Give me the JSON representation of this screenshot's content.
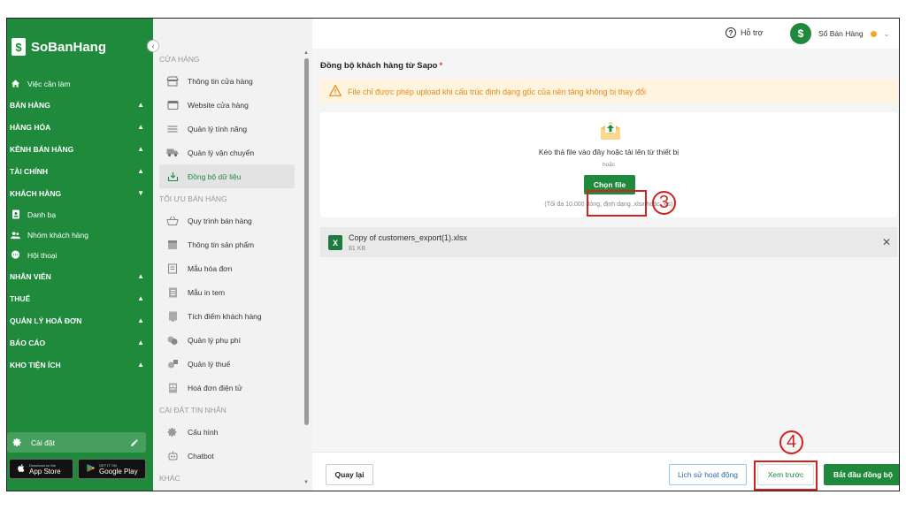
{
  "brand": {
    "name": "SoBanHang",
    "mark": "$"
  },
  "sidebar": {
    "items": [
      {
        "label": "Việc cần làm",
        "type": "link",
        "icon": "home-icon"
      },
      {
        "label": "BÁN HÀNG",
        "type": "group",
        "chevron": "▲"
      },
      {
        "label": "HÀNG HÓA",
        "type": "group",
        "chevron": "▲"
      },
      {
        "label": "KÊNH BÁN HÀNG",
        "type": "group",
        "chevron": "▲"
      },
      {
        "label": "TÀI CHÍNH",
        "type": "group",
        "chevron": "▲"
      },
      {
        "label": "KHÁCH HÀNG",
        "type": "group",
        "chevron": "▼"
      },
      {
        "label": "Danh bạ",
        "type": "sub",
        "icon": "contact-book-icon"
      },
      {
        "label": "Nhóm khách hàng",
        "type": "sub",
        "icon": "group-icon"
      },
      {
        "label": "Hội thoại",
        "type": "sub",
        "icon": "chat-icon"
      },
      {
        "label": "NHÂN VIÊN",
        "type": "group",
        "chevron": "▲"
      },
      {
        "label": "THUẾ",
        "type": "group",
        "chevron": "▲"
      },
      {
        "label": "QUẢN LÝ HOÁ ĐƠN",
        "type": "group",
        "chevron": "▲"
      },
      {
        "label": "BÁO CÁO",
        "type": "group",
        "chevron": "▲"
      },
      {
        "label": "KHO TIỆN ÍCH",
        "type": "group",
        "chevron": "▲"
      }
    ],
    "settings_label": "Cài đặt",
    "app_store": {
      "small": "Download on the",
      "label": "App Store"
    },
    "google_play": {
      "small": "GET IT ON",
      "label": "Google Play"
    }
  },
  "menu": {
    "sections": [
      {
        "head": "CỬA HÀNG",
        "items": [
          {
            "label": "Thông tin cửa hàng",
            "icon": "store-icon"
          },
          {
            "label": "Website cửa hàng",
            "icon": "browser-icon"
          },
          {
            "label": "Quản lý tính năng",
            "icon": "list-icon"
          },
          {
            "label": "Quản lý vận chuyển",
            "icon": "truck-icon"
          },
          {
            "label": "Đồng bộ dữ liệu",
            "icon": "sync-download-icon",
            "active": true
          }
        ]
      },
      {
        "head": "TỐI ƯU BÁN HÀNG",
        "items": [
          {
            "label": "Quy trình bán hàng",
            "icon": "basket-icon"
          },
          {
            "label": "Thông tin sản phẩm",
            "icon": "box-icon"
          },
          {
            "label": "Mẫu hóa đơn",
            "icon": "invoice-icon"
          },
          {
            "label": "Mẫu in tem",
            "icon": "label-icon"
          },
          {
            "label": "Tích điểm khách hàng",
            "icon": "points-icon"
          },
          {
            "label": "Quản lý phụ phí",
            "icon": "coins-icon"
          },
          {
            "label": "Quản lý thuế",
            "icon": "tax-icon"
          },
          {
            "label": "Hoá đơn điện tử",
            "icon": "e-invoice-icon"
          }
        ]
      },
      {
        "head": "CÀI ĐẶT TIN NHẮN",
        "items": [
          {
            "label": "Cấu hình",
            "icon": "gear-icon"
          },
          {
            "label": "Chatbot",
            "icon": "robot-icon"
          }
        ]
      },
      {
        "head": "KHÁC",
        "items": []
      }
    ]
  },
  "header": {
    "help_label": "Hỗ trợ",
    "user_name": "Sổ Bán Hàng",
    "status_color": "#f5a623"
  },
  "main": {
    "title": "Đồng bộ khách hàng từ Sapo",
    "required_mark": "*",
    "warning": "File chỉ được phép upload khi cấu trúc định dạng gốc của nền tảng không bị thay đổi",
    "dropzone": {
      "instruction": "Kéo thả file vào đây hoặc tải lên từ thiết bị",
      "or": "hoặc",
      "choose_label": "Chọn file",
      "hint": "(Tối đa 10.000 dòng, định dạng .xlsx hoặc .xls)"
    },
    "file": {
      "name": "Copy of customers_export(1).xlsx",
      "size": "81 KB",
      "icon": "excel-icon"
    },
    "annotations": {
      "step3": "3",
      "step4": "4"
    },
    "footer": {
      "back_label": "Quay lại",
      "history_label": "Lịch sử hoạt động",
      "preview_label": "Xem trước",
      "start_label": "Bắt đầu đồng bộ"
    }
  },
  "colors": {
    "brand_green": "#1f8a3c",
    "warning_orange": "#e8881a",
    "annotation_red": "#d32020",
    "link_blue": "#2a6ab0"
  }
}
